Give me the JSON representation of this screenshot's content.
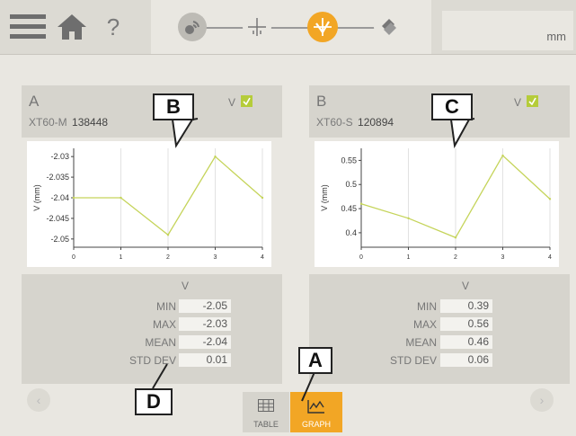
{
  "toolbar": {
    "menu_icon": "hamburger-menu-icon",
    "home_icon": "home-icon",
    "help_label": "?",
    "steps": [
      {
        "icon": "sensor-connect-icon",
        "active": false
      },
      {
        "icon": "crosshair-icon",
        "active": false
      },
      {
        "icon": "measure-icon",
        "active": true
      },
      {
        "icon": "result-report-icon",
        "active": false
      }
    ],
    "unit": "mm"
  },
  "panels": [
    {
      "letter": "A",
      "model": "XT60-M",
      "serial": "138448",
      "v_label": "V",
      "checked": true,
      "callout": "B",
      "stats": {
        "header": "V",
        "rows": [
          {
            "label": "MIN",
            "value": "-2.05"
          },
          {
            "label": "MAX",
            "value": "-2.03"
          },
          {
            "label": "MEAN",
            "value": "-2.04"
          },
          {
            "label": "STD DEV",
            "value": "0.01"
          }
        ]
      }
    },
    {
      "letter": "B",
      "model": "XT60-S",
      "serial": "120894",
      "v_label": "V",
      "checked": true,
      "callout": "C",
      "stats": {
        "header": "V",
        "rows": [
          {
            "label": "MIN",
            "value": "0.39"
          },
          {
            "label": "MAX",
            "value": "0.56"
          },
          {
            "label": "MEAN",
            "value": "0.46"
          },
          {
            "label": "STD DEV",
            "value": "0.06"
          }
        ]
      }
    }
  ],
  "chart_data": [
    {
      "type": "line",
      "ylabel": "V (mm)",
      "xlabel": "",
      "x": [
        0,
        1,
        2,
        3,
        4
      ],
      "values": [
        -2.04,
        -2.04,
        -2.049,
        -2.03,
        -2.04
      ],
      "xlim": [
        0,
        4
      ],
      "ylim": [
        -2.052,
        -2.028
      ],
      "yticks": [
        -2.03,
        -2.035,
        -2.04,
        -2.045,
        -2.05
      ],
      "ytick_labels": [
        "-2.03",
        "-2.035",
        "-2.04",
        "-2.045",
        "-2.05"
      ],
      "xtick_labels": [
        "0",
        "1",
        "2",
        "3",
        "4"
      ],
      "color": "#c5d45a"
    },
    {
      "type": "line",
      "ylabel": "V (mm)",
      "xlabel": "",
      "x": [
        0,
        1,
        2,
        3,
        4
      ],
      "values": [
        0.46,
        0.43,
        0.39,
        0.56,
        0.47
      ],
      "xlim": [
        0,
        4
      ],
      "ylim": [
        0.37,
        0.575
      ],
      "yticks": [
        0.55,
        0.5,
        0.45,
        0.4
      ],
      "ytick_labels": [
        "0.55",
        "0.5",
        "0.45",
        "0.4"
      ],
      "xtick_labels": [
        "0",
        "1",
        "2",
        "3",
        "4"
      ],
      "color": "#c5d45a"
    }
  ],
  "bottom": {
    "prev_label": "‹",
    "next_label": "›",
    "tab_table": "TABLE",
    "tab_graph": "GRAPH",
    "callout_a": "A",
    "callout_d": "D"
  },
  "colors": {
    "accent": "#f2a625",
    "check": "#b5cc3a",
    "line": "#c5d45a"
  }
}
